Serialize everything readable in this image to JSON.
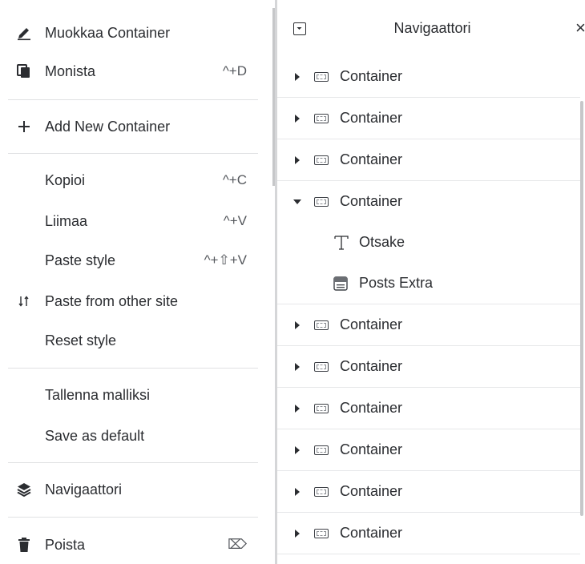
{
  "context_menu": {
    "items": [
      {
        "label": "Muokkaa Container",
        "shortcut": "",
        "icon": "pencil-icon"
      },
      {
        "label": "Monista",
        "shortcut": "^+D",
        "icon": "duplicate-icon"
      },
      {
        "label": "Add New Container",
        "shortcut": "",
        "icon": "plus-icon"
      },
      {
        "label": "Kopioi",
        "shortcut": "^+C",
        "icon": ""
      },
      {
        "label": "Liimaa",
        "shortcut": "^+V",
        "icon": ""
      },
      {
        "label": "Paste style",
        "shortcut": "^+⇧+V",
        "icon": ""
      },
      {
        "label": "Paste from other site",
        "shortcut": "",
        "icon": "transfer-arrows-icon"
      },
      {
        "label": "Reset style",
        "shortcut": "",
        "icon": ""
      },
      {
        "label": "Tallenna malliksi",
        "shortcut": "",
        "icon": ""
      },
      {
        "label": "Save as default",
        "shortcut": "",
        "icon": ""
      },
      {
        "label": "Navigaattori",
        "shortcut": "",
        "icon": "layers-icon"
      },
      {
        "label": "Poista",
        "shortcut": "⌦",
        "icon": "trash-icon"
      }
    ]
  },
  "navigator": {
    "title": "Navigaattori",
    "close_symbol": "×",
    "tree": [
      {
        "label": "Container",
        "expanded": false
      },
      {
        "label": "Container",
        "expanded": false
      },
      {
        "label": "Container",
        "expanded": false
      },
      {
        "label": "Container",
        "expanded": true
      },
      {
        "label": "Otsake",
        "child": true,
        "icon": "heading-icon"
      },
      {
        "label": "Posts Extra",
        "child": true,
        "icon": "posts-icon"
      },
      {
        "label": "Container",
        "expanded": false
      },
      {
        "label": "Container",
        "expanded": false
      },
      {
        "label": "Container",
        "expanded": false
      },
      {
        "label": "Container",
        "expanded": false
      },
      {
        "label": "Container",
        "expanded": false
      },
      {
        "label": "Container",
        "expanded": false
      }
    ]
  },
  "colors": {
    "text": "#2b2d31",
    "separator": "#e0e1e3",
    "scrollbar": "#c6c7c9"
  }
}
